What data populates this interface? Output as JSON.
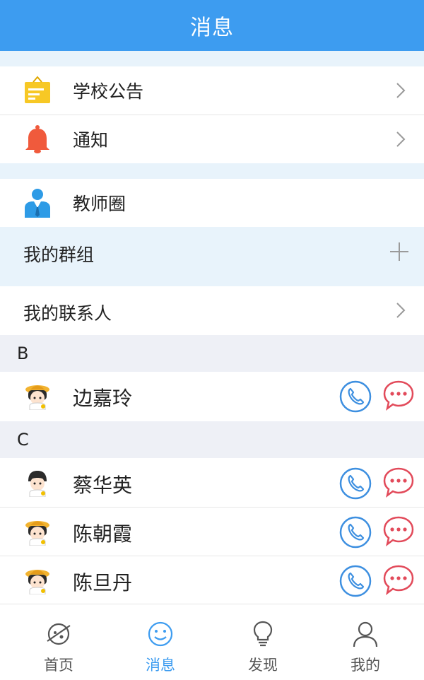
{
  "header": {
    "title": "消息"
  },
  "menu": {
    "announcement": "学校公告",
    "notice": "通知",
    "teacher_circle": "教师圈",
    "my_groups": "我的群组",
    "my_contacts": "我的联系人"
  },
  "sections": [
    {
      "letter": "B",
      "contacts": [
        {
          "name": "边嘉玲",
          "avatar": "girl-hat-avatar"
        }
      ]
    },
    {
      "letter": "C",
      "contacts": [
        {
          "name": "蔡华英",
          "avatar": "boy-avatar"
        },
        {
          "name": "陈朝霞",
          "avatar": "girl-hat-avatar"
        },
        {
          "name": "陈旦丹",
          "avatar": "girl-hat-avatar"
        }
      ]
    }
  ],
  "tabbar": {
    "items": [
      {
        "label": "首页",
        "icon": "planet-icon"
      },
      {
        "label": "消息",
        "icon": "smiley-icon",
        "active": true
      },
      {
        "label": "发现",
        "icon": "lightbulb-icon"
      },
      {
        "label": "我的",
        "icon": "person-icon"
      }
    ]
  },
  "colors": {
    "accent": "#3d9cf0",
    "call": "#3d8fe0",
    "message": "#e24a5a",
    "announcement": "#f7c825",
    "notice": "#f05a3c"
  }
}
